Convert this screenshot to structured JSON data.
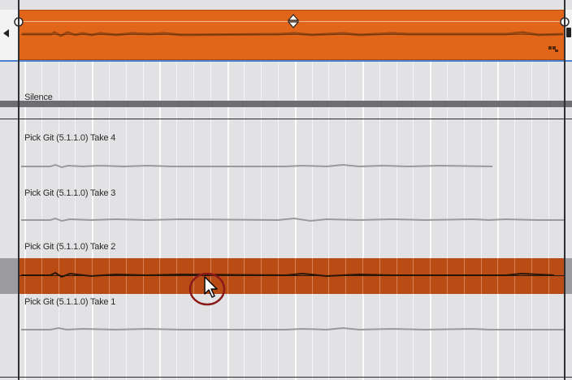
{
  "lanes": {
    "silence_label": "Silence",
    "takes": [
      {
        "label": "Pick Git (5.1.1.0) Take 4"
      },
      {
        "label": "Pick Git (5.1.1.0) Take 3"
      },
      {
        "label": "Pick Git (5.1.1.0) Take 2"
      },
      {
        "label": "Pick Git (5.1.1.0) Take 1"
      }
    ],
    "selected_take_index": 2
  },
  "colors": {
    "clip_orange": "#e2661a",
    "selected_take": "#b84c14",
    "divider_blue": "#4a7fd0",
    "cursor_ring": "#8a1a1a"
  },
  "icons": [
    "comp-marker-icon",
    "scroll-left-icon",
    "clip-corner-icon",
    "mouse-pointer-icon",
    "volume-handle-icon"
  ]
}
